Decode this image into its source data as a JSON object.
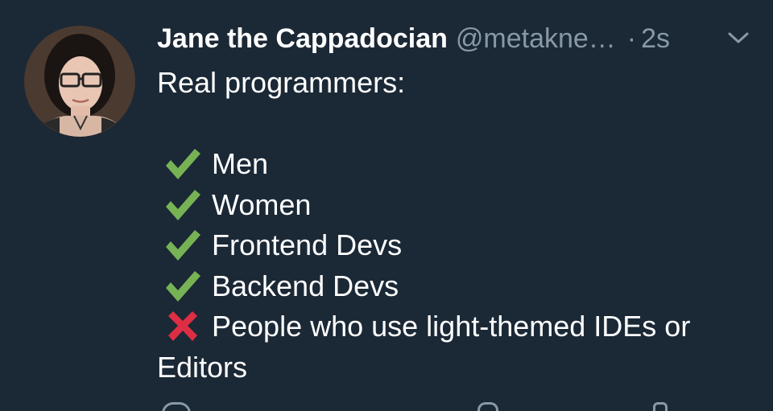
{
  "tweet": {
    "author": {
      "display_name": "Jane the Cappadocian",
      "handle": "@metakne…",
      "avatar": "profile-photo"
    },
    "meta": {
      "separator": "·",
      "time": "2s"
    },
    "text": {
      "intro": "Real programmers:",
      "list": [
        {
          "mark": "check-mark-icon",
          "text": "Men"
        },
        {
          "mark": "check-mark-icon",
          "text": "Women"
        },
        {
          "mark": "check-mark-icon",
          "text": "Frontend Devs"
        },
        {
          "mark": "check-mark-icon",
          "text": "Backend Devs"
        },
        {
          "mark": "cross-mark-icon",
          "text": "People who use light-themed IDEs or"
        }
      ],
      "continuation": "Editors"
    },
    "icons": {
      "menu": "chevron-down-icon",
      "actions": [
        "reply-icon",
        "retweet-icon",
        "like-icon",
        "share-icon"
      ]
    }
  },
  "colors": {
    "background": "#1b2836",
    "text": "#ffffff",
    "secondary": "#8899a6",
    "check": "#77b255",
    "cross": "#dd2e44"
  }
}
